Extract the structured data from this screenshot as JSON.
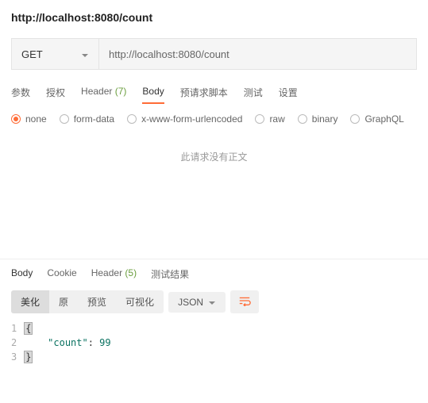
{
  "title": "http://localhost:8080/count",
  "request": {
    "method": "GET",
    "url": "http://localhost:8080/count"
  },
  "tabs": {
    "params": "参数",
    "auth": "授权",
    "header_label": "Header",
    "header_count": "(7)",
    "body": "Body",
    "prerequest": "预请求脚本",
    "tests": "测试",
    "settings": "设置"
  },
  "body_types": {
    "none": "none",
    "formdata": "form-data",
    "xwww": "x-www-form-urlencoded",
    "raw": "raw",
    "binary": "binary",
    "graphql": "GraphQL"
  },
  "empty_body_text": "此请求没有正文",
  "response_tabs": {
    "body": "Body",
    "cookie": "Cookie",
    "header_label": "Header",
    "header_count": "(5)",
    "test_results": "测试结果"
  },
  "view_modes": {
    "pretty": "美化",
    "raw": "原",
    "preview": "预览",
    "visualize": "可视化"
  },
  "format": "JSON",
  "response_code": {
    "line1_a": "{",
    "line2_indent": "    ",
    "line2_key": "\"count\"",
    "line2_colon": ": ",
    "line2_val": "99",
    "line3_a": "}"
  }
}
